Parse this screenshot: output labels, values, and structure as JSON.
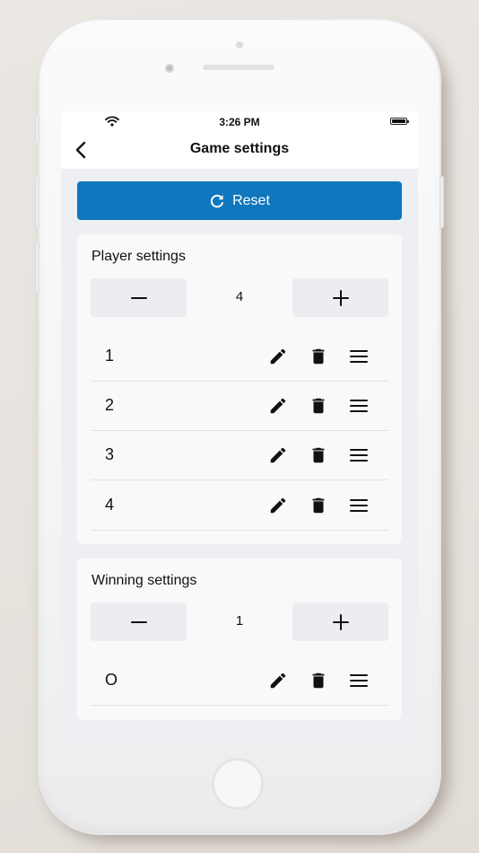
{
  "status_bar": {
    "time": "3:26 PM"
  },
  "nav": {
    "title": "Game settings"
  },
  "reset": {
    "label": "Reset"
  },
  "player_settings": {
    "title": "Player settings",
    "count": "4",
    "players": [
      {
        "label": "1"
      },
      {
        "label": "2"
      },
      {
        "label": "3"
      },
      {
        "label": "4"
      }
    ]
  },
  "winning_settings": {
    "title": "Winning settings",
    "count": "1",
    "items": [
      {
        "label": "O"
      }
    ]
  },
  "icons": {
    "back": "chevron-left-icon",
    "reset": "refresh-icon",
    "minus": "minus-icon",
    "plus": "plus-icon",
    "edit": "pencil-icon",
    "delete": "trash-icon",
    "reorder": "drag-handle-icon"
  },
  "colors": {
    "accent": "#0f77bd",
    "screen_background": "#eeeff3",
    "card_background": "#f9f9fa",
    "stepper_background": "#ebedf0"
  }
}
